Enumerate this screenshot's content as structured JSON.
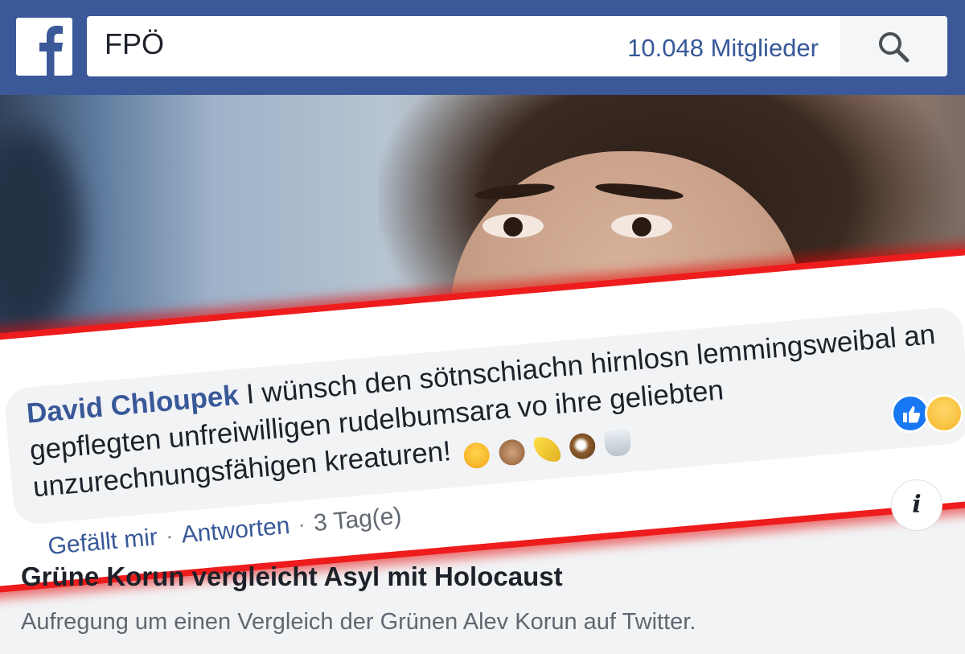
{
  "header": {
    "logo_icon": "facebook-f-icon",
    "search_query": "FPÖ",
    "members_label": "10.048 Mitglieder",
    "search_icon": "magnifier-icon",
    "brand_color": "#3b5998"
  },
  "comment": {
    "author": "David Chloupek",
    "text": "I wünsch den sötnschiachn hirnlosn lemmingsweibal an gepflegten unfreiwilligen rudelbumsara vo ihre geliebten unzurechnungsfähigen kreaturen!",
    "emojis": [
      "wink-emoji",
      "monkey-emoji",
      "banana-emoji",
      "coconut-emoji",
      "toilet-emoji"
    ],
    "actions": {
      "like": "Gefällt mir",
      "reply": "Antworten",
      "time": "3 Tag(e)"
    },
    "reactions": [
      "like-reaction-icon",
      "haha-reaction-icon"
    ]
  },
  "link_preview": {
    "info_icon": "info-icon",
    "title": "Grüne Korun vergleicht Asyl mit Holocaust",
    "description": "Aufregung um einen Vergleich der Grünen Alev Korun auf Twitter."
  }
}
